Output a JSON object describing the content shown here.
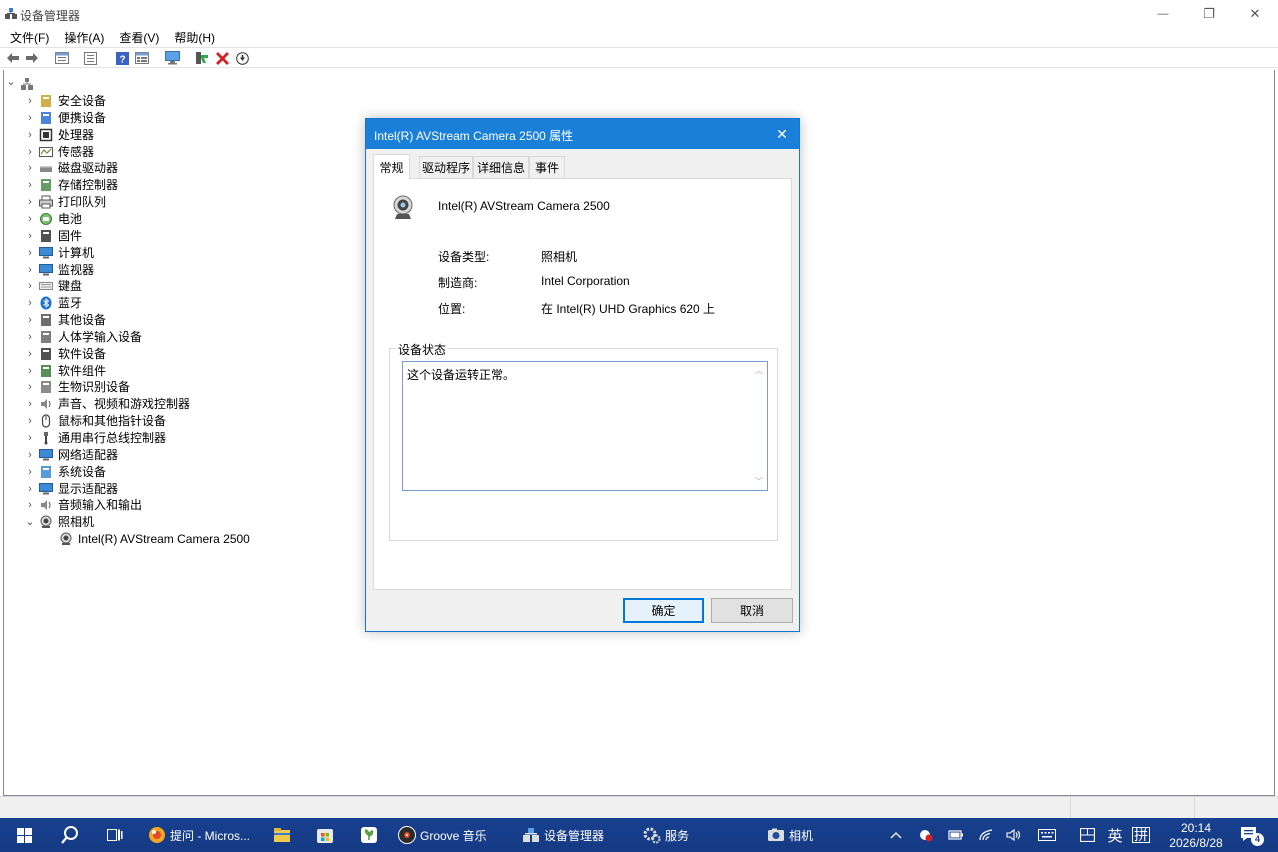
{
  "window": {
    "title": "设备管理器",
    "controls": {
      "minimize": "—",
      "restore": "❐",
      "close": "✕"
    }
  },
  "menu": [
    "文件(F)",
    "操作(A)",
    "查看(V)",
    "帮助(H)"
  ],
  "toolbar_icons": [
    "back-arrow-icon",
    "forward-arrow-icon",
    "properties-icon",
    "view-icon",
    "help-icon",
    "view-list-icon",
    "monitor-icon",
    "update-driver-icon",
    "remove-device-icon",
    "download-icon"
  ],
  "tree": {
    "root_icon": "computer-network-icon",
    "categories": [
      {
        "label": "安全设备",
        "icon": "security-icon",
        "expanded": false
      },
      {
        "label": "便携设备",
        "icon": "portable-device-icon",
        "expanded": false
      },
      {
        "label": "处理器",
        "icon": "processor-icon",
        "expanded": false
      },
      {
        "label": "传感器",
        "icon": "sensor-icon",
        "expanded": false
      },
      {
        "label": "磁盘驱动器",
        "icon": "disk-drive-icon",
        "expanded": false
      },
      {
        "label": "存储控制器",
        "icon": "storage-controller-icon",
        "expanded": false
      },
      {
        "label": "打印队列",
        "icon": "printer-icon",
        "expanded": false
      },
      {
        "label": "电池",
        "icon": "battery-icon",
        "expanded": false
      },
      {
        "label": "固件",
        "icon": "firmware-icon",
        "expanded": false
      },
      {
        "label": "计算机",
        "icon": "computer-icon",
        "expanded": false
      },
      {
        "label": "监视器",
        "icon": "monitor-icon",
        "expanded": false
      },
      {
        "label": "键盘",
        "icon": "keyboard-icon",
        "expanded": false
      },
      {
        "label": "蓝牙",
        "icon": "bluetooth-icon",
        "expanded": false
      },
      {
        "label": "其他设备",
        "icon": "other-device-icon",
        "expanded": false
      },
      {
        "label": "人体学输入设备",
        "icon": "hid-icon",
        "expanded": false
      },
      {
        "label": "软件设备",
        "icon": "software-device-icon",
        "expanded": false
      },
      {
        "label": "软件组件",
        "icon": "software-component-icon",
        "expanded": false
      },
      {
        "label": "生物识别设备",
        "icon": "biometric-icon",
        "expanded": false
      },
      {
        "label": "声音、视频和游戏控制器",
        "icon": "sound-icon",
        "expanded": false
      },
      {
        "label": "鼠标和其他指针设备",
        "icon": "mouse-icon",
        "expanded": false
      },
      {
        "label": "通用串行总线控制器",
        "icon": "usb-icon",
        "expanded": false
      },
      {
        "label": "网络适配器",
        "icon": "network-adapter-icon",
        "expanded": false
      },
      {
        "label": "系统设备",
        "icon": "system-device-icon",
        "expanded": false
      },
      {
        "label": "显示适配器",
        "icon": "display-adapter-icon",
        "expanded": false
      },
      {
        "label": "音频输入和输出",
        "icon": "audio-io-icon",
        "expanded": false
      },
      {
        "label": "照相机",
        "icon": "camera-icon",
        "expanded": true
      }
    ],
    "child": {
      "label": "Intel(R) AVStream Camera 2500",
      "icon": "webcam-icon"
    }
  },
  "dialog": {
    "title": "Intel(R) AVStream Camera 2500 属性",
    "close": "✕",
    "tabs": [
      "常规",
      "驱动程序",
      "详细信息",
      "事件"
    ],
    "active_tab": "常规",
    "device_name": "Intel(R) AVStream Camera 2500",
    "properties": [
      {
        "label": "设备类型:",
        "value": "照相机"
      },
      {
        "label": "制造商:",
        "value": "Intel Corporation"
      },
      {
        "label": "位置:",
        "value": "在 Intel(R) UHD Graphics 620 上"
      }
    ],
    "status_group_label": "设备状态",
    "status_text": "这个设备运转正常。",
    "ok_label": "确定",
    "cancel_label": "取消"
  },
  "taskbar": {
    "items": [
      {
        "label": "提问 - Micros...",
        "icon": "browser-icon"
      },
      {
        "label": "",
        "icon": "file-explorer-icon"
      },
      {
        "label": "",
        "icon": "store-icon"
      },
      {
        "label": "",
        "icon": "app-icon"
      },
      {
        "label": "Groove 音乐",
        "icon": "groove-music-icon"
      },
      {
        "label": "设备管理器",
        "icon": "device-manager-icon"
      },
      {
        "label": "服务",
        "icon": "services-icon"
      },
      {
        "label": "相机",
        "icon": "camera-app-icon"
      }
    ],
    "tray": {
      "ime_lang": "英",
      "ime_mode": "拼",
      "time": "20:14",
      "date": "2026/8/28",
      "notification_count": "4"
    }
  },
  "colors": {
    "dialog_title": "#1a7fd8",
    "taskbar": "#17408e",
    "selection": "#0078d7"
  }
}
